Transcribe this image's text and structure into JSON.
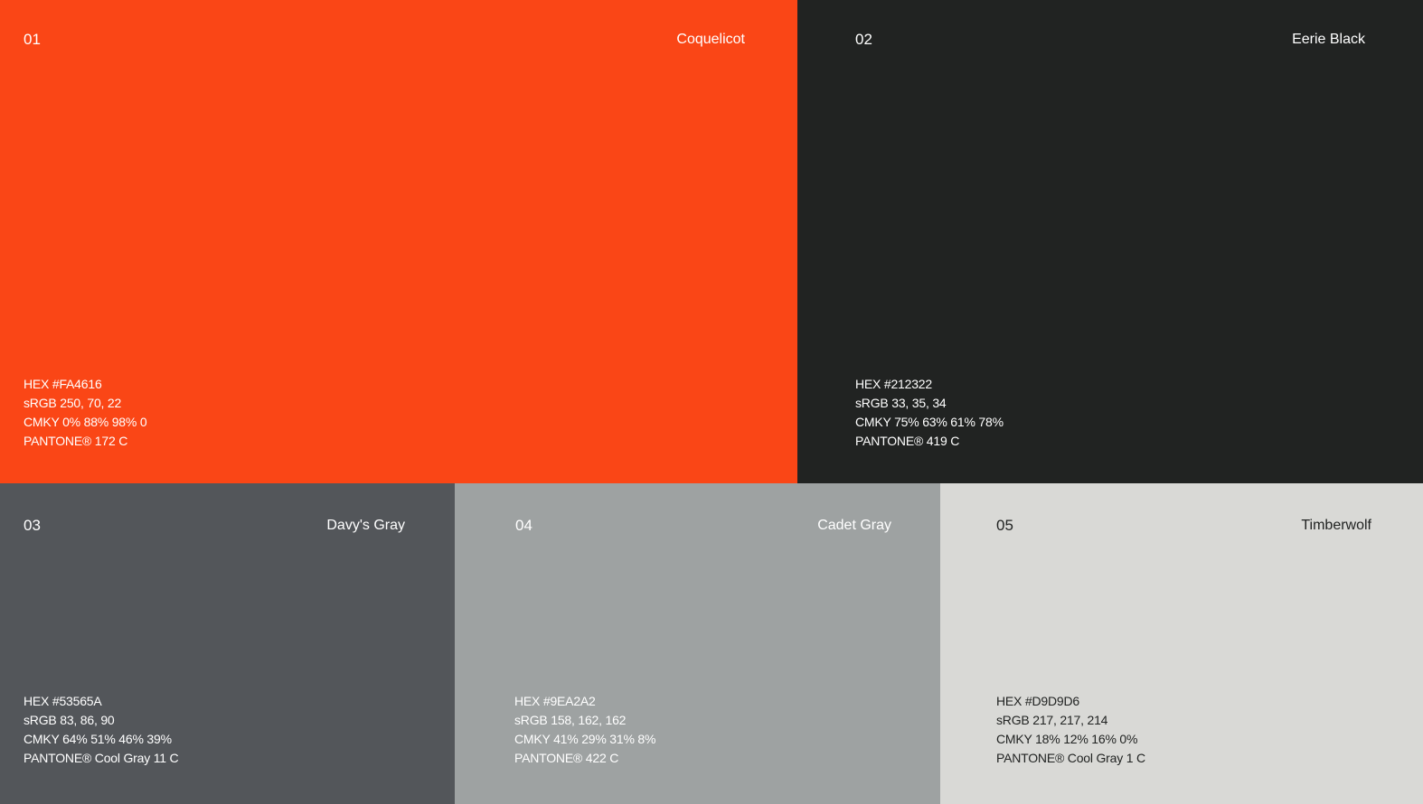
{
  "swatches": [
    {
      "number": "01",
      "name": "Coquelicot",
      "hex": "HEX #FA4616",
      "srgb": "sRGB 250, 70, 22",
      "cmyk": "CMKY 0% 88% 98% 0",
      "pantone": "PANTONE® 172 C",
      "background": "#FA4616",
      "text_color": "#FFFFFF"
    },
    {
      "number": "02",
      "name": "Eerie Black",
      "hex": "HEX #212322",
      "srgb": "sRGB 33, 35, 34",
      "cmyk": "CMKY 75% 63% 61% 78%",
      "pantone": "PANTONE® 419 C",
      "background": "#212322",
      "text_color": "#FFFFFF"
    },
    {
      "number": "03",
      "name": "Davy's Gray",
      "hex": "HEX #53565A",
      "srgb": "sRGB 83, 86, 90",
      "cmyk": "CMKY 64% 51% 46% 39%",
      "pantone": "PANTONE® Cool Gray 11 C",
      "background": "#53565A",
      "text_color": "#FFFFFF"
    },
    {
      "number": "04",
      "name": "Cadet Gray",
      "hex": "HEX #9EA2A2",
      "srgb": "sRGB 158, 162, 162",
      "cmyk": "CMKY 41% 29% 31% 8%",
      "pantone": "PANTONE® 422 C",
      "background": "#9EA2A2",
      "text_color": "#FFFFFF"
    },
    {
      "number": "05",
      "name": "Timberwolf",
      "hex": "HEX #D9D9D6",
      "srgb": "sRGB 217, 217, 214",
      "cmyk": "CMKY 18% 12% 16% 0%",
      "pantone": "PANTONE® Cool Gray 1 C",
      "background": "#D9D9D6",
      "text_color": "#212322"
    }
  ]
}
